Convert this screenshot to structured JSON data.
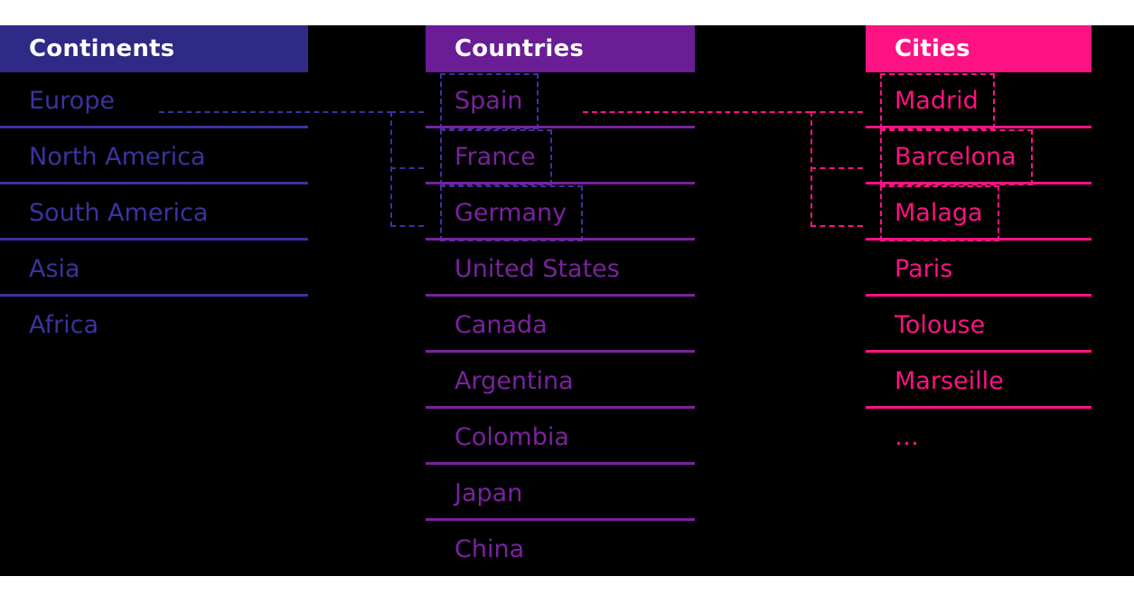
{
  "canvas": {
    "background": "#FFFFFF",
    "stage_background": "#000000"
  },
  "theme": {
    "continents_accent": "#2E2A85",
    "continents_text": "#3B32A0",
    "countries_accent": "#6A1D94",
    "countries_text": "#7A229E",
    "cities_accent": "#FC1283",
    "cities_text": "#FC1283",
    "header_text": "#FFFFFF"
  },
  "columns": {
    "continents": {
      "header": "Continents",
      "rows": [
        {
          "label": "Europe",
          "selected": false,
          "separator": true
        },
        {
          "label": "North America",
          "selected": false,
          "separator": true
        },
        {
          "label": "South America",
          "selected": false,
          "separator": true
        },
        {
          "label": "Asia",
          "selected": false,
          "separator": true
        },
        {
          "label": "Africa",
          "selected": false,
          "separator": false
        }
      ]
    },
    "countries": {
      "header": "Countries",
      "rows": [
        {
          "label": "Spain",
          "selected": true,
          "separator": true
        },
        {
          "label": "France",
          "selected": true,
          "separator": true
        },
        {
          "label": "Germany",
          "selected": true,
          "separator": true
        },
        {
          "label": "United States",
          "selected": false,
          "separator": true
        },
        {
          "label": "Canada",
          "selected": false,
          "separator": true
        },
        {
          "label": "Argentina",
          "selected": false,
          "separator": true
        },
        {
          "label": "Colombia",
          "selected": false,
          "separator": true
        },
        {
          "label": "Japan",
          "selected": false,
          "separator": true
        },
        {
          "label": "China",
          "selected": false,
          "separator": false
        }
      ]
    },
    "cities": {
      "header": "Cities",
      "rows": [
        {
          "label": "Madrid",
          "selected": true,
          "separator": true
        },
        {
          "label": "Barcelona",
          "selected": true,
          "separator": true
        },
        {
          "label": "Malaga",
          "selected": true,
          "separator": true
        },
        {
          "label": "Paris",
          "selected": false,
          "separator": true
        },
        {
          "label": "Tolouse",
          "selected": false,
          "separator": true
        },
        {
          "label": "Marseille",
          "selected": false,
          "separator": true
        },
        {
          "label": "…",
          "selected": false,
          "separator": false
        }
      ]
    }
  },
  "connections": {
    "continent_to_country": {
      "from": "Europe",
      "to": [
        "Spain",
        "France",
        "Germany"
      ],
      "color": "#3B32A0",
      "style": "dashed"
    },
    "country_to_city": {
      "from": "Spain",
      "to": [
        "Madrid",
        "Barcelona",
        "Malaga"
      ],
      "color": "#FC1283",
      "style": "dashed"
    }
  }
}
